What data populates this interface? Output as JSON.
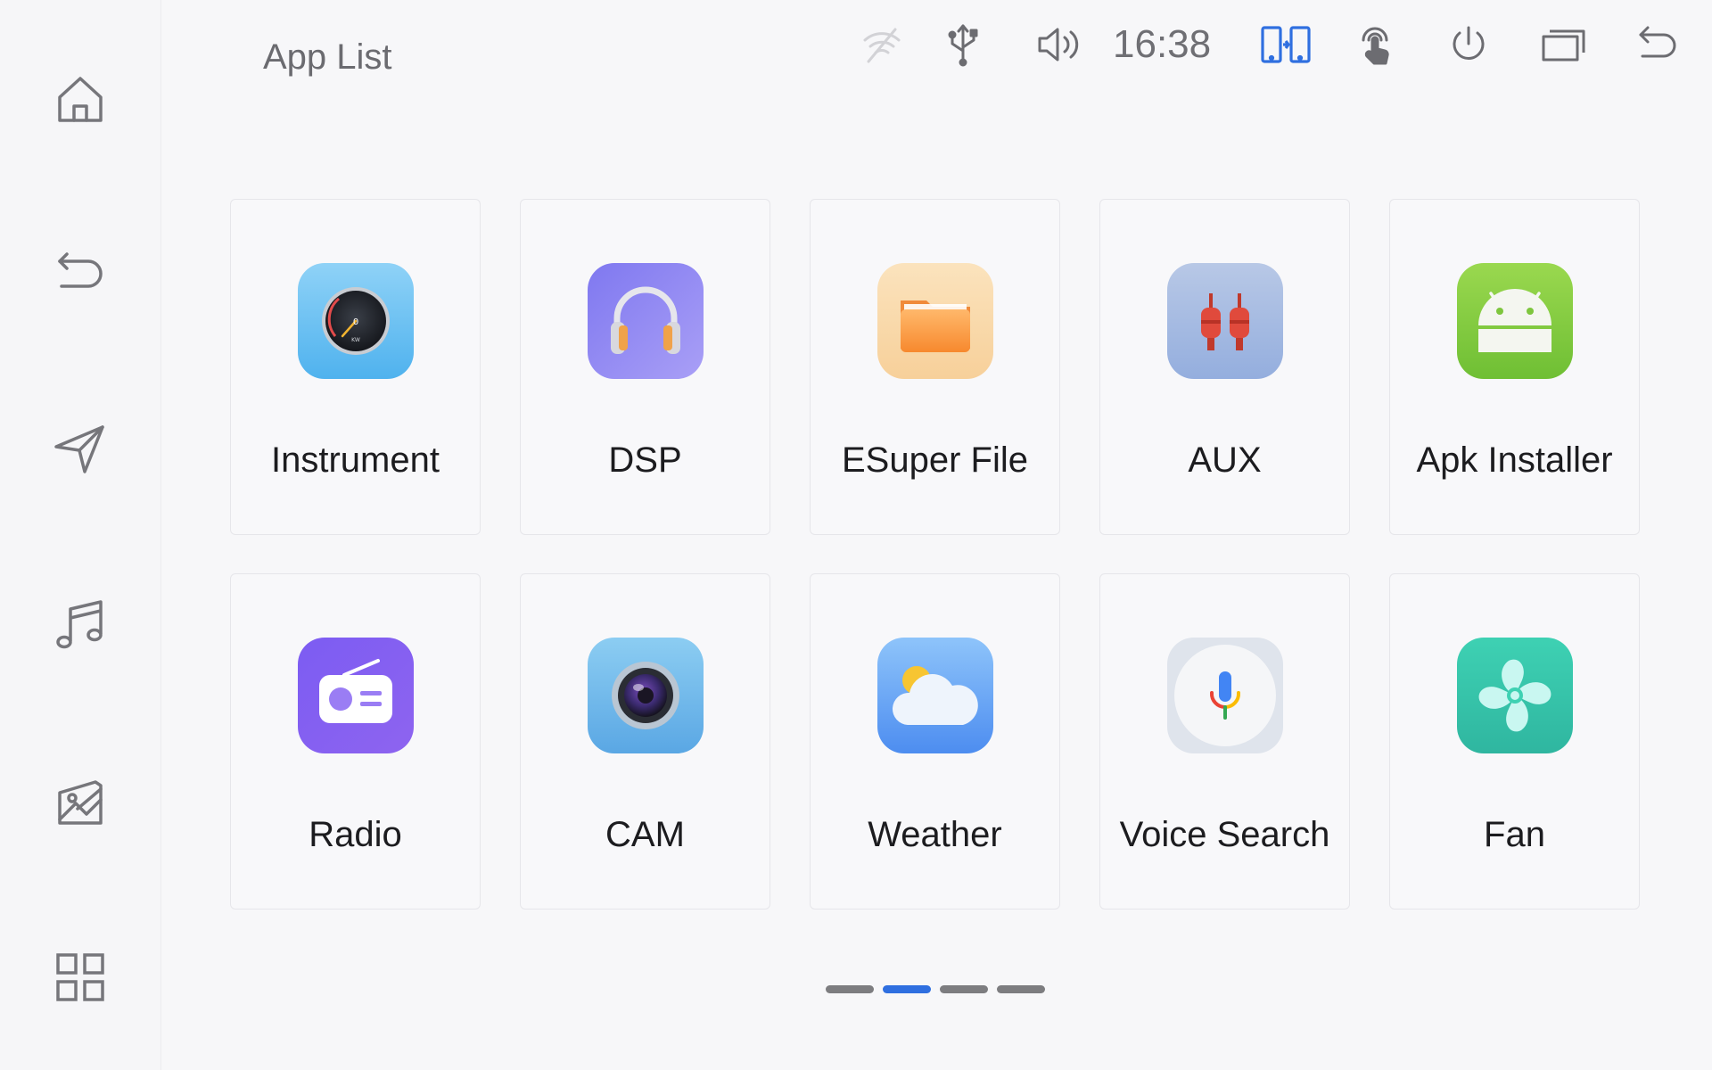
{
  "header": {
    "title": "App List",
    "time": "16:38"
  },
  "sidebar": {
    "items": [
      {
        "name": "home",
        "icon": "home-icon"
      },
      {
        "name": "back",
        "icon": "back-arrow-icon"
      },
      {
        "name": "navigation",
        "icon": "navigation-icon"
      },
      {
        "name": "music",
        "icon": "music-note-icon"
      },
      {
        "name": "gallery",
        "icon": "image-icon"
      },
      {
        "name": "apps",
        "icon": "app-grid-icon"
      }
    ]
  },
  "statusbar": {
    "icons": [
      "wifi-off-icon",
      "usb-icon",
      "volume-icon",
      "split-screen-icon",
      "touch-icon",
      "power-icon",
      "recent-apps-icon",
      "back-icon"
    ],
    "accent_color": "#2f6fe0"
  },
  "apps": [
    {
      "label": "Instrument",
      "icon": "speedometer-icon"
    },
    {
      "label": "DSP",
      "icon": "headphones-icon"
    },
    {
      "label": "ESuper File",
      "icon": "folder-icon"
    },
    {
      "label": "AUX",
      "icon": "rca-plug-icon"
    },
    {
      "label": "Apk Installer",
      "icon": "android-icon"
    },
    {
      "label": "Radio",
      "icon": "radio-icon"
    },
    {
      "label": "CAM",
      "icon": "camera-lens-icon"
    },
    {
      "label": "Weather",
      "icon": "weather-icon"
    },
    {
      "label": "Voice Search",
      "icon": "microphone-icon"
    },
    {
      "label": "Fan",
      "icon": "fan-icon"
    }
  ],
  "pager": {
    "pages": 4,
    "current": 2
  }
}
